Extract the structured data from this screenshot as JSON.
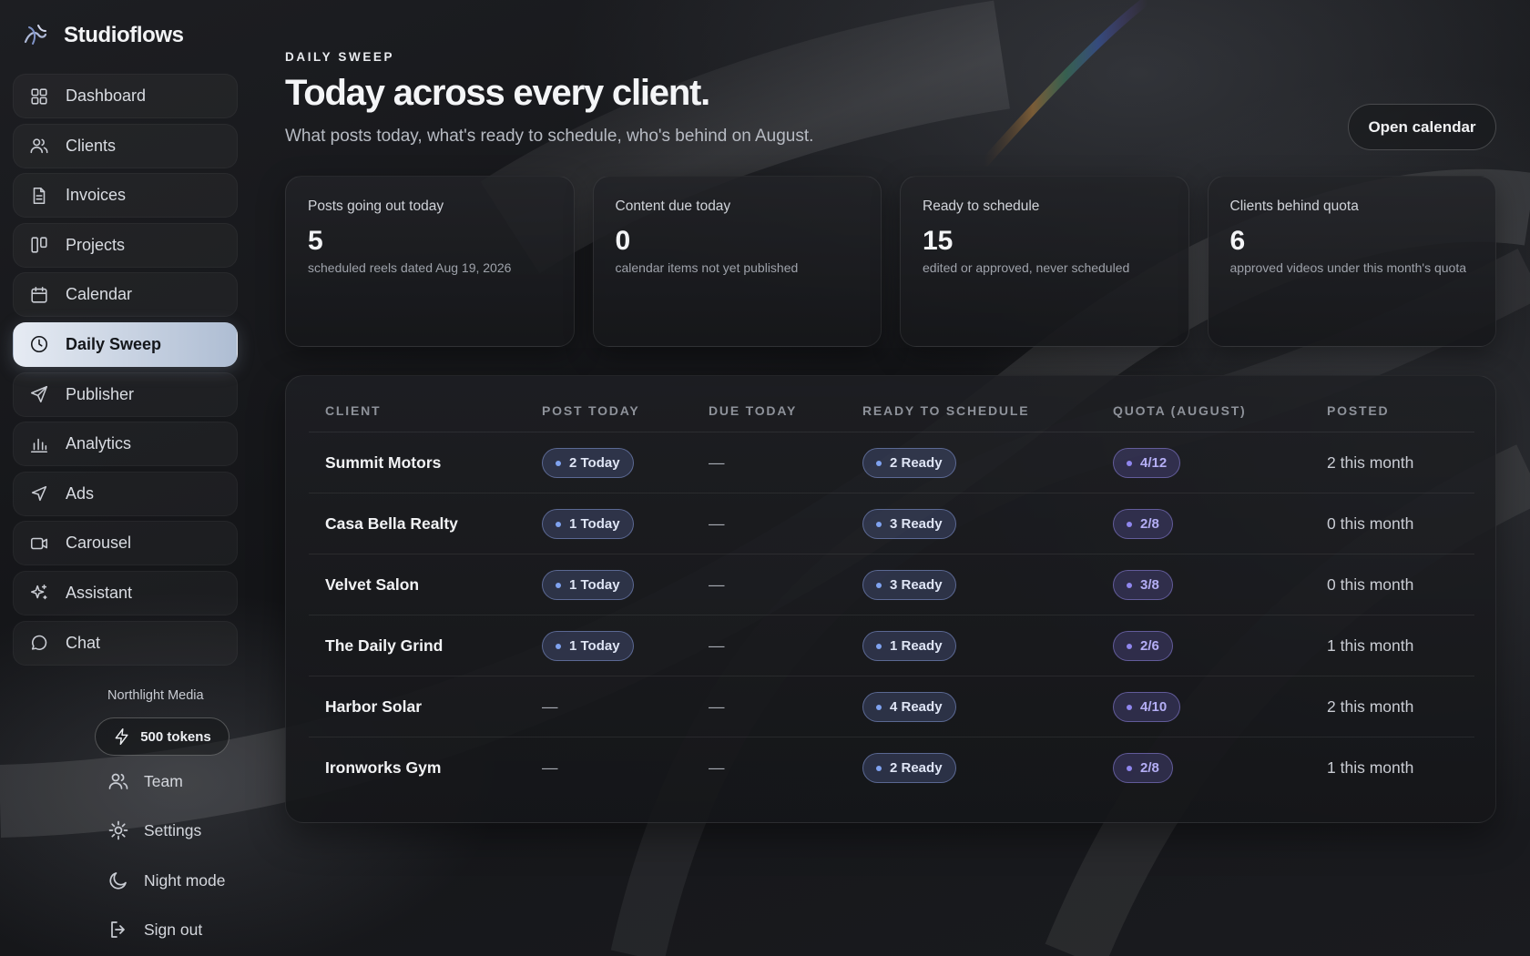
{
  "brand": {
    "name": "Studioflows"
  },
  "nav": [
    {
      "label": "Dashboard",
      "icon": "grid-icon"
    },
    {
      "label": "Clients",
      "icon": "users-icon"
    },
    {
      "label": "Invoices",
      "icon": "document-icon"
    },
    {
      "label": "Projects",
      "icon": "columns-icon"
    },
    {
      "label": "Calendar",
      "icon": "calendar-icon"
    },
    {
      "label": "Daily Sweep",
      "icon": "clock-icon",
      "active": true
    },
    {
      "label": "Publisher",
      "icon": "send-icon"
    },
    {
      "label": "Analytics",
      "icon": "bar-chart-icon"
    },
    {
      "label": "Ads",
      "icon": "navigation-icon"
    },
    {
      "label": "Carousel",
      "icon": "video-icon"
    },
    {
      "label": "Assistant",
      "icon": "sparkles-icon"
    },
    {
      "label": "Chat",
      "icon": "chat-bubble-icon"
    }
  ],
  "account": {
    "org": "Northlight Media",
    "tokens": "500 tokens",
    "team": "Team",
    "settings": "Settings",
    "night_mode": "Night mode",
    "sign_out": "Sign out"
  },
  "header": {
    "eyebrow": "DAILY SWEEP",
    "title": "Today across every client.",
    "subtitle": "What posts today, what's ready to schedule, who's behind on August.",
    "open_calendar": "Open calendar"
  },
  "cards": [
    {
      "label": "Posts going out today",
      "value": "5",
      "sub": "scheduled reels dated Aug 19, 2026"
    },
    {
      "label": "Content due today",
      "value": "0",
      "sub": "calendar items not yet published"
    },
    {
      "label": "Ready to schedule",
      "value": "15",
      "sub": "edited or approved, never scheduled"
    },
    {
      "label": "Clients behind quota",
      "value": "6",
      "sub": "approved videos under this month's quota"
    }
  ],
  "table": {
    "columns": [
      "CLIENT",
      "POST TODAY",
      "DUE TODAY",
      "READY TO SCHEDULE",
      "QUOTA (AUGUST)",
      "POSTED"
    ],
    "rows": [
      {
        "client": "Summit Motors",
        "post_today": "2 Today",
        "due_today": "—",
        "ready": "2 Ready",
        "quota": "4/12",
        "posted": "2 this month"
      },
      {
        "client": "Casa Bella Realty",
        "post_today": "1 Today",
        "due_today": "—",
        "ready": "3 Ready",
        "quota": "2/8",
        "posted": "0 this month"
      },
      {
        "client": "Velvet Salon",
        "post_today": "1 Today",
        "due_today": "—",
        "ready": "3 Ready",
        "quota": "3/8",
        "posted": "0 this month"
      },
      {
        "client": "The Daily Grind",
        "post_today": "1 Today",
        "due_today": "—",
        "ready": "1 Ready",
        "quota": "2/6",
        "posted": "1 this month"
      },
      {
        "client": "Harbor Solar",
        "post_today": "—",
        "due_today": "—",
        "ready": "4 Ready",
        "quota": "4/10",
        "posted": "2 this month"
      },
      {
        "client": "Ironworks Gym",
        "post_today": "—",
        "due_today": "—",
        "ready": "2 Ready",
        "quota": "2/8",
        "posted": "1 this month"
      }
    ]
  },
  "colors": {
    "accent_pill": "#7fa2f0",
    "quota_pill": "#8f86ee",
    "active_nav": "#cfd8e6"
  }
}
